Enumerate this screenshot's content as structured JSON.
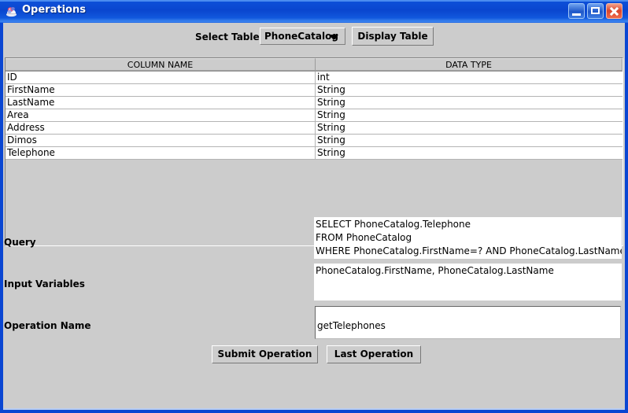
{
  "window": {
    "title": "Operations",
    "icon": "java-duke-icon",
    "controls": {
      "minimize": "minimize-button",
      "maximize": "maximize-button",
      "close": "close-button"
    },
    "colors": {
      "titlebar_accent": "#0a46d2",
      "client_background": "#cccccc",
      "field_background": "#ffffff",
      "close_button": "#d9452c"
    }
  },
  "toolbar": {
    "select_table_label": "Select Table",
    "table_combo": {
      "selected": "PhoneCatalog",
      "options": [
        "PhoneCatalog"
      ],
      "arrow": "chevron-down-icon"
    },
    "display_table_label": "Display Table"
  },
  "table": {
    "headers": [
      "COLUMN NAME",
      "DATA TYPE"
    ],
    "rows": [
      {
        "column_name": "ID",
        "data_type": "int"
      },
      {
        "column_name": "FirstName",
        "data_type": "String"
      },
      {
        "column_name": "LastName",
        "data_type": "String"
      },
      {
        "column_name": "Area",
        "data_type": "String"
      },
      {
        "column_name": "Address",
        "data_type": "String"
      },
      {
        "column_name": "Dimos",
        "data_type": "String"
      },
      {
        "column_name": "Telephone",
        "data_type": "String"
      }
    ]
  },
  "form": {
    "query": {
      "label": "Query",
      "lines": [
        "SELECT PhoneCatalog.Telephone",
        "FROM PhoneCatalog",
        "WHERE PhoneCatalog.FirstName=? AND PhoneCatalog.LastName=?"
      ],
      "placeholder": ""
    },
    "input_variables": {
      "label": "Input Variables",
      "lines": [
        "PhoneCatalog.FirstName, PhoneCatalog.LastName"
      ],
      "placeholder": ""
    },
    "operation_name": {
      "label": "Operation Name",
      "value": "getTelephones",
      "placeholder": ""
    }
  },
  "actions": {
    "submit_label": "Submit Operation",
    "last_label": "Last Operation"
  }
}
